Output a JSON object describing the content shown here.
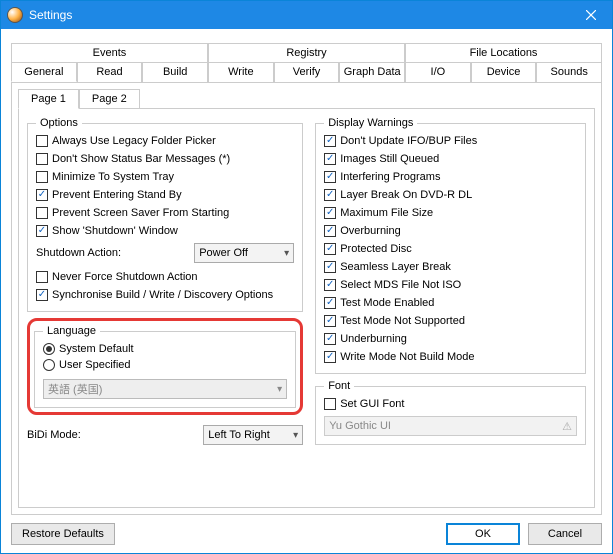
{
  "window": {
    "title": "Settings"
  },
  "tabs_row1": [
    "Events",
    "Registry",
    "File Locations"
  ],
  "tabs_row2": [
    "General",
    "Read",
    "Build",
    "Write",
    "Verify",
    "Graph Data",
    "I/O",
    "Device",
    "Sounds"
  ],
  "active_main_tab": "General",
  "subtabs": [
    "Page 1",
    "Page 2"
  ],
  "active_subtab": "Page 1",
  "options": {
    "legend": "Options",
    "items": [
      {
        "label": "Always Use Legacy Folder Picker",
        "checked": false
      },
      {
        "label": "Don't Show Status Bar Messages (*)",
        "checked": false
      },
      {
        "label": "Minimize To System Tray",
        "checked": false
      },
      {
        "label": "Prevent Entering Stand By",
        "checked": true
      },
      {
        "label": "Prevent Screen Saver From Starting",
        "checked": false
      },
      {
        "label": "Show 'Shutdown' Window",
        "checked": true
      }
    ],
    "shutdown_label": "Shutdown Action:",
    "shutdown_value": "Power Off",
    "extra": [
      {
        "label": "Never Force Shutdown Action",
        "checked": false
      },
      {
        "label": "Synchronise Build / Write / Discovery Options",
        "checked": true
      }
    ]
  },
  "language": {
    "legend": "Language",
    "sys_default": "System Default",
    "user_spec": "User Specified",
    "selected": "sys",
    "combo_value": "英語 (英国)"
  },
  "bidi": {
    "label": "BiDi Mode:",
    "value": "Left To Right"
  },
  "display_warnings": {
    "legend": "Display Warnings",
    "items": [
      {
        "label": "Don't Update IFO/BUP Files",
        "checked": true
      },
      {
        "label": "Images Still Queued",
        "checked": true
      },
      {
        "label": "Interfering Programs",
        "checked": true
      },
      {
        "label": "Layer Break On DVD-R DL",
        "checked": true
      },
      {
        "label": "Maximum File Size",
        "checked": true
      },
      {
        "label": "Overburning",
        "checked": true
      },
      {
        "label": "Protected Disc",
        "checked": true
      },
      {
        "label": "Seamless Layer Break",
        "checked": true
      },
      {
        "label": "Select MDS File Not ISO",
        "checked": true
      },
      {
        "label": "Test Mode Enabled",
        "checked": true
      },
      {
        "label": "Test Mode Not Supported",
        "checked": true
      },
      {
        "label": "Underburning",
        "checked": true
      },
      {
        "label": "Write Mode Not Build Mode",
        "checked": true
      }
    ]
  },
  "font": {
    "legend": "Font",
    "set_gui_font": "Set GUI Font",
    "set_gui_font_checked": false,
    "value": "Yu Gothic UI"
  },
  "buttons": {
    "restore": "Restore Defaults",
    "ok": "OK",
    "cancel": "Cancel"
  }
}
